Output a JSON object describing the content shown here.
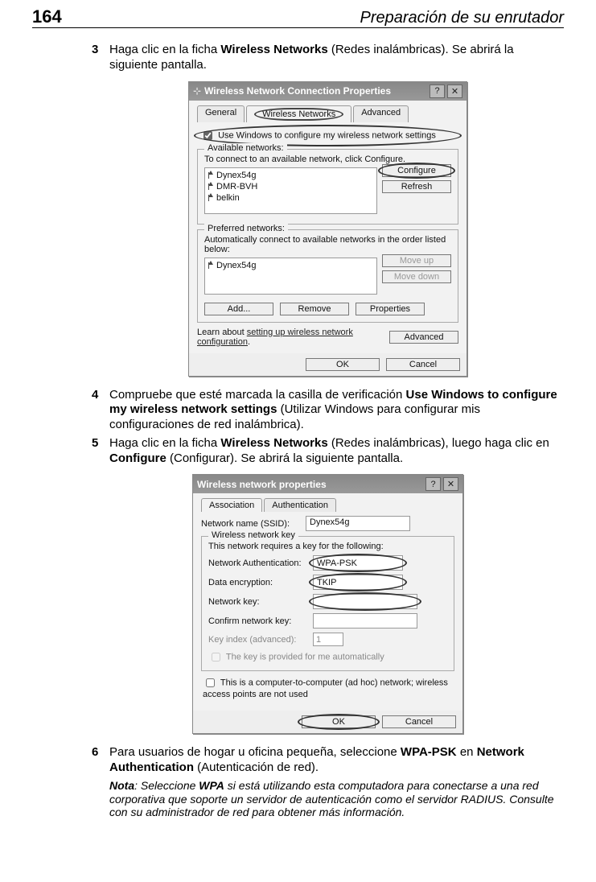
{
  "page": {
    "number": "164",
    "header_title": "Preparación de su enrutador"
  },
  "steps": {
    "s3": {
      "num": "3",
      "pre": "Haga clic en la ficha ",
      "bold1": "Wireless Networks",
      "post": " (Redes inalámbricas). Se abrirá la siguiente pantalla."
    },
    "s4": {
      "num": "4",
      "pre": "Compruebe que esté marcada la casilla de verificación ",
      "bold1": "Use Windows to configure my wireless network settings",
      "mid": " (Utilizar Windows para configurar mis configuraciones de red inalámbrica)."
    },
    "s5": {
      "num": "5",
      "pre": "Haga clic en la ficha ",
      "bold1": "Wireless Networks",
      "mid": " (Redes inalámbricas), luego haga clic en ",
      "bold2": "Configure",
      "post": " (Configurar). Se abrirá la siguiente pantalla."
    },
    "s6": {
      "num": "6",
      "pre": "Para usuarios de hogar u oficina pequeña, seleccione ",
      "bold1": "WPA-PSK",
      "mid": " en ",
      "bold2": "Network Authentication",
      "post": " (Autenticación de red)."
    }
  },
  "note": {
    "lead": "Nota",
    "t1": ": Seleccione ",
    "bold": "WPA",
    "t2": " si está utilizando esta computadora para conectarse a una red corporativa que soporte un servidor de autenticación como el servidor RADIUS. Consulte con su administrador de red para obtener más información."
  },
  "ss1": {
    "title": "Wireless Network Connection Properties",
    "tab_general": "General",
    "tab_wireless": "Wireless Networks",
    "tab_advanced": "Advanced",
    "use_windows": "Use Windows to configure my wireless network settings",
    "avail_label": "Available networks:",
    "avail_hint": "To connect to an available network, click Configure.",
    "nets": [
      "Dynex54g",
      "DMR-BVH",
      "belkin"
    ],
    "btn_configure": "Configure",
    "btn_refresh": "Refresh",
    "pref_label": "Preferred networks:",
    "pref_hint": "Automatically connect to available networks in the order listed below:",
    "pref_nets": [
      "Dynex54g"
    ],
    "btn_moveup": "Move up",
    "btn_movedown": "Move down",
    "btn_add": "Add...",
    "btn_remove": "Remove",
    "btn_props": "Properties",
    "learn1": "Learn about ",
    "learn_link": "setting up wireless network configuration",
    "learn2": ".",
    "btn_advanced": "Advanced",
    "btn_ok": "OK",
    "btn_cancel": "Cancel"
  },
  "ss2": {
    "title": "Wireless network properties",
    "tab_assoc": "Association",
    "tab_auth": "Authentication",
    "ssid_label": "Network name (SSID):",
    "ssid_value": "Dynex54g",
    "wnk_label": "Wireless network key",
    "wnk_hint": "This network requires a key for the following:",
    "na_label": "Network Authentication:",
    "na_value": "WPA-PSK",
    "de_label": "Data encryption:",
    "de_value": "TKIP",
    "nk_label": "Network key:",
    "ck_label": "Confirm network key:",
    "ki_label": "Key index (advanced):",
    "ki_value": "1",
    "auto_label": "The key is provided for me automatically",
    "adhoc_label": "This is a computer-to-computer (ad hoc) network; wireless access points are not used",
    "btn_ok": "OK",
    "btn_cancel": "Cancel"
  }
}
